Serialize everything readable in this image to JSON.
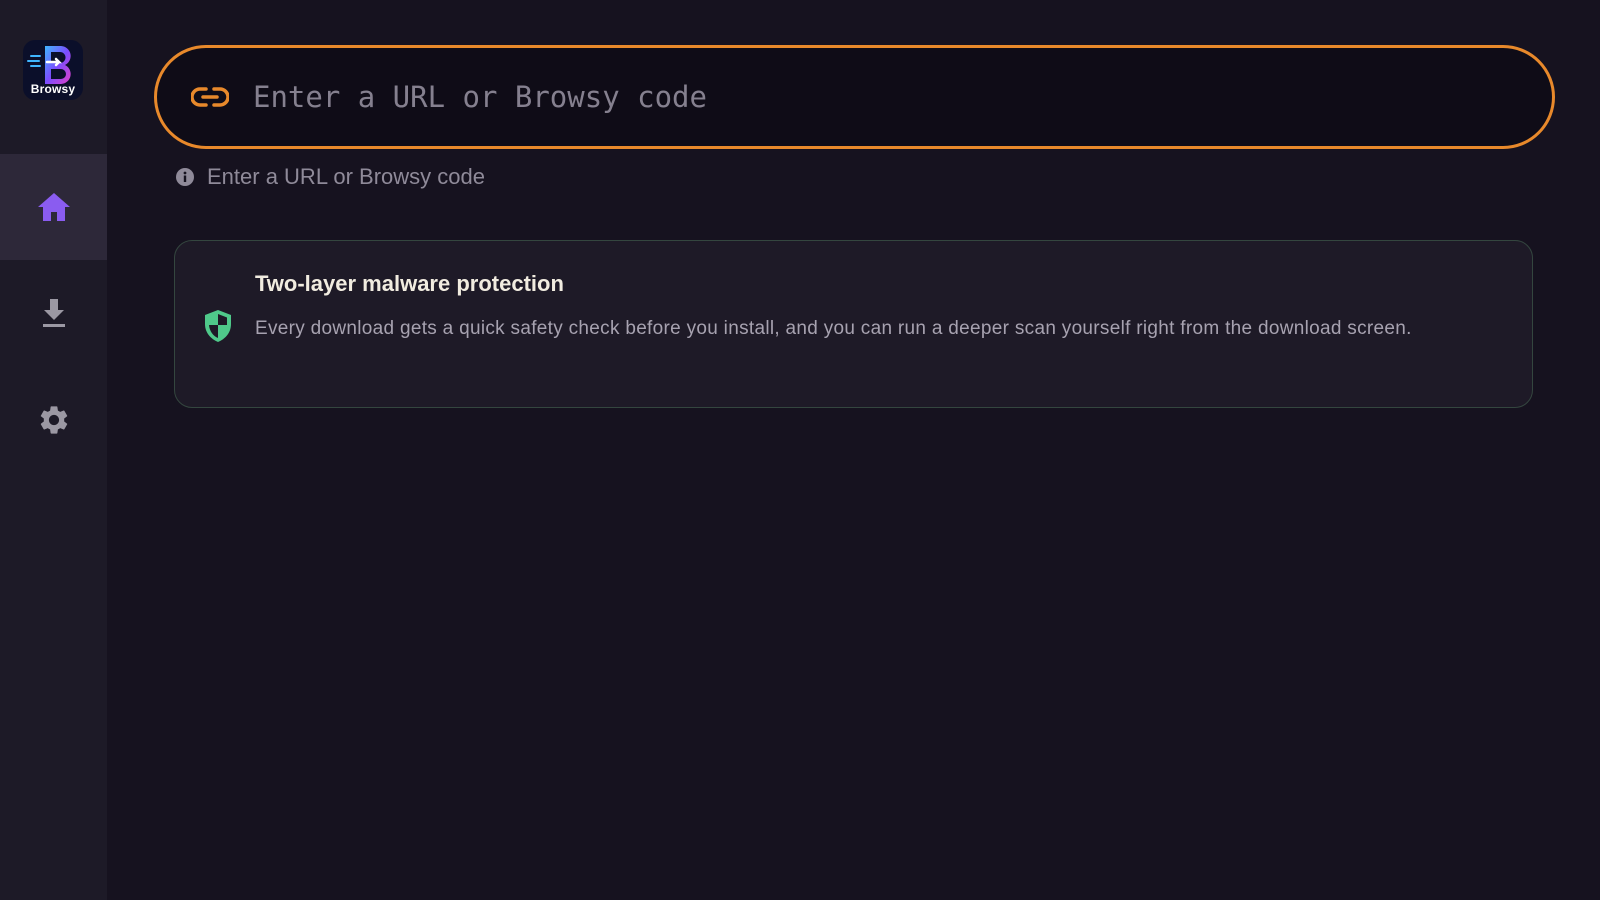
{
  "app": {
    "logo_text": "Browsy"
  },
  "sidebar": {
    "items": [
      {
        "name": "home",
        "active": true
      },
      {
        "name": "downloads",
        "active": false
      },
      {
        "name": "settings",
        "active": false
      }
    ]
  },
  "url_bar": {
    "placeholder": "Enter a URL or Browsy code",
    "value": ""
  },
  "hint": {
    "text": "Enter a URL or Browsy code"
  },
  "info_card": {
    "title": "Two-layer malware protection",
    "body": "Every download gets a quick safety check before you install, and you can run a deeper scan yourself right from the download screen."
  },
  "colors": {
    "accent": "#e8892b",
    "active_nav_icon": "#8a5cf0",
    "shield": "#4fc98a",
    "background": "#16121f",
    "sidebar": "#1d1a27"
  }
}
